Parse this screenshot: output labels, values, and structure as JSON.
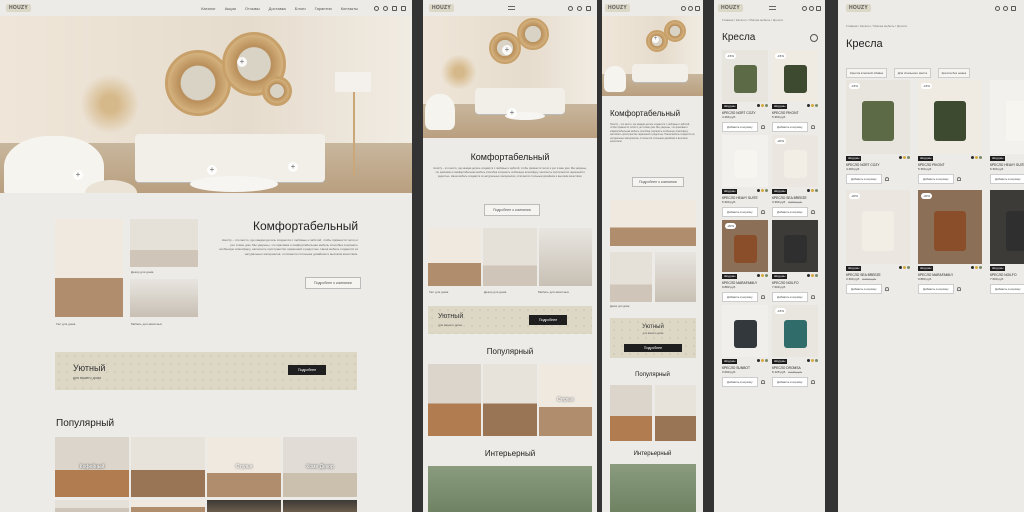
{
  "brand": {
    "logo": "HOUZY"
  },
  "nav": {
    "items": [
      "Каталог",
      "Акции",
      "Отзывы",
      "Доставка",
      "Блоги",
      "Гарантия",
      "Контакты"
    ]
  },
  "icons": [
    "search-icon",
    "heart-icon",
    "bag-icon",
    "phone-icon",
    "menu-icon",
    "filter-icon"
  ],
  "hero_hotspot": "+",
  "about": {
    "title": "Комфортабельный",
    "text": "Houzzy – это место, где каждая деталь создается с любовью и заботой, чтобы привнести тепло и уют в ваш дом. Мы уверены, что красивая и комфортабельная мебель способна сохранить особенную атмосферу, наполнить пространство гармонией и радостью. Наша мебель создается из натуральных материалов, отличается стильным дизайном и высоким качеством.",
    "button": "Подробнее о компании",
    "captions": [
      "Уют для дома",
      "Декор для дома",
      "Мебель для животных"
    ]
  },
  "banner": {
    "title": "Уютный",
    "subtitle": "для вашего дома",
    "button": "Подробнее"
  },
  "popular": {
    "title": "Популярный",
    "items": [
      "Кофейный",
      "Стулья",
      "Коме Декор"
    ]
  },
  "interior": {
    "title": "Интерьерный"
  },
  "catalog": {
    "breadcrumbs": "Главная / Каталог / Мягкая мебель / Кресла",
    "title": "Кресла",
    "filters": [
      "Кресла в мягкой обивке",
      "Для спального места",
      "Кресла без ножек"
    ],
    "badge": "Шоурумы",
    "add_to_cart": "Добавить в корзину",
    "products": [
      {
        "name": "Кресло Nort Cozy",
        "price": "4 490 руб.",
        "old": "",
        "discount": "-15%"
      },
      {
        "name": "Кресло Pikont",
        "price": "5 360 руб.",
        "old": "",
        "discount": "-15%"
      },
      {
        "name": "Кресло Heavy Suite",
        "price": "6 300 руб.",
        "old": "",
        "discount": ""
      },
      {
        "name": "Кресло Sea Breeze",
        "price": "3 390 руб.",
        "old": "3 990 руб.",
        "discount": "-20%"
      },
      {
        "name": "Кресло Marafamily",
        "price": "9 880 руб.",
        "old": "",
        "discount": "-20%"
      },
      {
        "name": "Кресло Noilfo",
        "price": "7 600 руб.",
        "old": "",
        "discount": ""
      },
      {
        "name": "Кресло Sunbot",
        "price": "3 090 руб.",
        "old": "",
        "discount": ""
      },
      {
        "name": "Кресло Dromsa",
        "price": "6 125 руб.",
        "old": "7 170 руб.",
        "discount": "-15%"
      }
    ]
  },
  "colors": {
    "dark": "#1f1f1f",
    "banner": "#ddd8c5",
    "bg": "#ecebe7",
    "accent": "#d4a93f"
  }
}
